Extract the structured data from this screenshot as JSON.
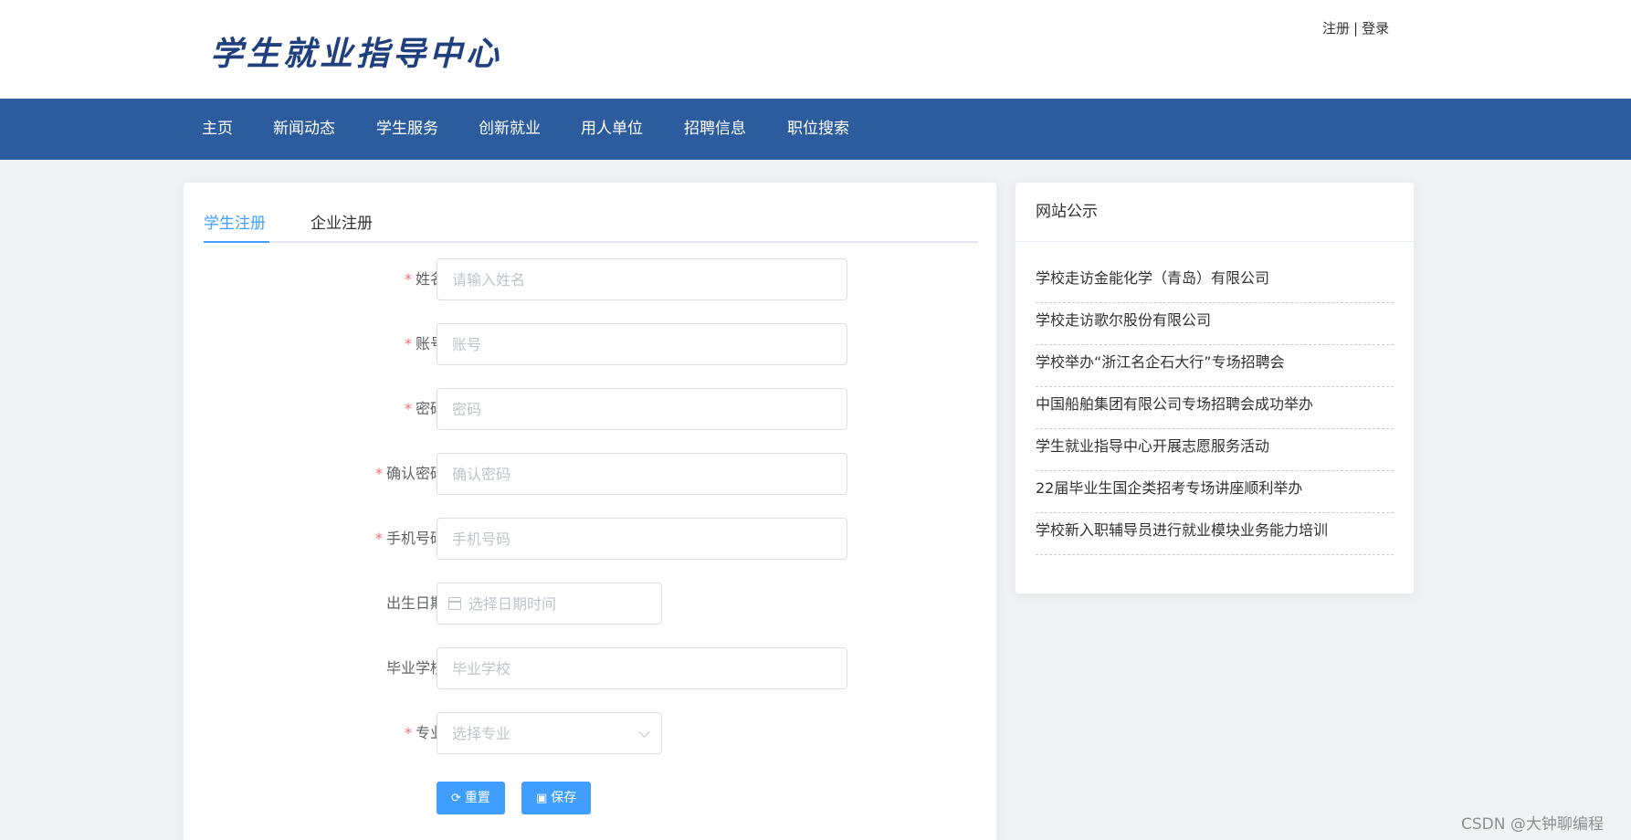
{
  "header": {
    "logo_text": "学生就业指导中心",
    "register_link": "注册",
    "separator": "|",
    "login_link": "登录"
  },
  "nav": {
    "items": [
      {
        "label": "主页"
      },
      {
        "label": "新闻动态"
      },
      {
        "label": "学生服务"
      },
      {
        "label": "创新就业"
      },
      {
        "label": "用人单位"
      },
      {
        "label": "招聘信息"
      },
      {
        "label": "职位搜索"
      }
    ]
  },
  "tabs": [
    {
      "label": "学生注册",
      "active": true
    },
    {
      "label": "企业注册",
      "active": false
    }
  ],
  "form": {
    "fields": [
      {
        "label": "姓名",
        "required": true,
        "placeholder": "请输入姓名",
        "value": ""
      },
      {
        "label": "账号",
        "required": true,
        "placeholder": "账号",
        "value": ""
      },
      {
        "label": "密码",
        "required": true,
        "placeholder": "密码",
        "value": ""
      },
      {
        "label": "确认密码",
        "required": true,
        "placeholder": "确认密码",
        "value": ""
      },
      {
        "label": "手机号码",
        "required": true,
        "placeholder": "手机号码",
        "value": ""
      },
      {
        "label": "出生日期",
        "required": false,
        "placeholder": "选择日期时间",
        "value": ""
      },
      {
        "label": "毕业学校",
        "required": false,
        "placeholder": "毕业学校",
        "value": ""
      },
      {
        "label": "专业",
        "required": true,
        "placeholder": "选择专业",
        "value": ""
      }
    ],
    "required_mark": "*",
    "reset_label": "重置",
    "save_label": "保存"
  },
  "sidebar": {
    "title": "网站公示",
    "items": [
      {
        "text": "学校走访金能化学（青岛）有限公司"
      },
      {
        "text": "学校走访歌尔股份有限公司"
      },
      {
        "text": "学校举办“浙江名企石大行”专场招聘会"
      },
      {
        "text": "中国船舶集团有限公司专场招聘会成功举办"
      },
      {
        "text": "学生就业指导中心开展志愿服务活动"
      },
      {
        "text": "22届毕业生国企类招考专场讲座顺利举办"
      },
      {
        "text": "学校新入职辅导员进行就业模块业务能力培训"
      }
    ]
  },
  "watermark": "CSDN @大钟聊编程",
  "colors": {
    "nav_bg": "#2d5c9e",
    "primary": "#409eff",
    "required": "#f56c6c",
    "logo": "#1f3f7e"
  }
}
